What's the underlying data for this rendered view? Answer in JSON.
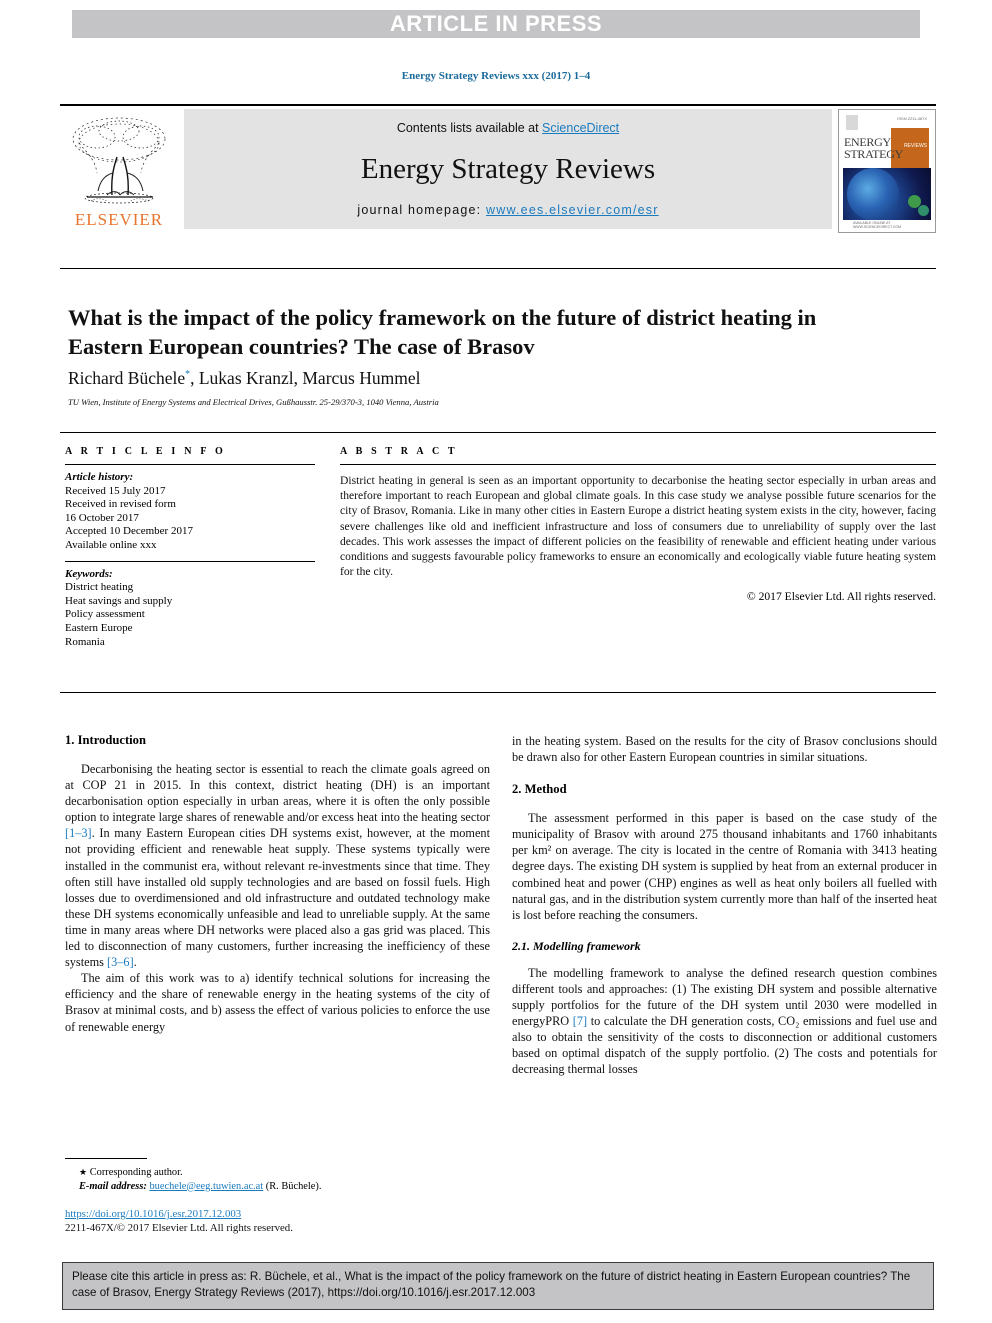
{
  "banner": {
    "text": "ARTICLE IN PRESS"
  },
  "running_head": "Energy Strategy Reviews xxx (2017) 1–4",
  "masthead": {
    "publisher": "ELSEVIER",
    "contents_prefix": "Contents lists available at ",
    "sciencedirect": "ScienceDirect",
    "journal_title": "Energy Strategy Reviews",
    "homepage_prefix": "journal homepage: ",
    "homepage_url": "www.ees.elsevier.com/esr",
    "cover": {
      "title_line1": "ENERGY",
      "title_line2": "STRATEGY",
      "badge": "REVIEWS",
      "top_note": "ISSN 2211-467X",
      "foot_note": "AVAILABLE ONLINE AT WWW.SCIENCEDIRECT.COM"
    }
  },
  "article": {
    "title": "What is the impact of the policy framework on the future of district heating in Eastern European countries? The case of Brasov",
    "authors": "Richard Büchele",
    "authors_rest": ", Lukas Kranzl, Marcus Hummel",
    "corresponding_marker": "*",
    "affiliation": "TU Wien, Institute of Energy Systems and Electrical Drives, Gußhausstr. 25-29/370-3, 1040 Vienna, Austria"
  },
  "article_info": {
    "heading": "A R T I C L E   I N F O",
    "history_label": "Article history:",
    "history": [
      "Received 15 July 2017",
      "Received in revised form",
      "16 October 2017",
      "Accepted 10 December 2017",
      "Available online xxx"
    ],
    "keywords_label": "Keywords:",
    "keywords": [
      "District heating",
      "Heat savings and supply",
      "Policy assessment",
      "Eastern Europe",
      "Romania"
    ]
  },
  "abstract": {
    "heading": "A B S T R A C T",
    "text": "District heating in general is seen as an important opportunity to decarbonise the heating sector especially in urban areas and therefore important to reach European and global climate goals. In this case study we analyse possible future scenarios for the city of Brasov, Romania. Like in many other cities in Eastern Europe a district heating system exists in the city, however, facing severe challenges like old and inefficient infrastructure and loss of consumers due to unreliability of supply over the last decades. This work assesses the impact of different policies on the feasibility of renewable and efficient heating under various conditions and suggests favourable policy frameworks to ensure an economically and ecologically viable future heating system for the city.",
    "copyright": "© 2017 Elsevier Ltd. All rights reserved."
  },
  "body": {
    "intro_heading": "1. Introduction",
    "intro_p1_a": "Decarbonising the heating sector is essential to reach the climate goals agreed on at COP 21 in 2015. In this context, district heating (DH) is an important decarbonisation option especially in urban areas, where it is often the only possible option to integrate large shares of renewable and/or excess heat into the heating sector ",
    "intro_p1_ref1": "[1–3]",
    "intro_p1_b": ". In many Eastern European cities DH systems exist, however, at the moment not providing efficient and renewable heat supply. These systems typically were installed in the communist era, without relevant re-investments since that time. They often still have installed old supply technologies and are based on fossil fuels. High losses due to overdimensioned and old infrastructure and outdated technology make these DH systems economically unfeasible and lead to unreliable supply. At the same time in many areas where DH networks were placed also a gas grid was placed. This led to disconnection of many customers, further increasing the inefficiency of these systems ",
    "intro_p1_ref2": "[3–6]",
    "intro_p1_c": ".",
    "intro_p2_a": "The aim of this work was to a) identify technical solutions for increasing the efficiency and the share of renewable energy in the heating systems of the city of Brasov at minimal costs, and b) assess the effect of various policies to enforce the use of renewable energy",
    "intro_p2_cont": "in the heating system. Based on the results for the city of Brasov conclusions should be drawn also for other Eastern European countries in similar situations.",
    "method_heading": "2. Method",
    "method_p1": "The assessment performed in this paper is based on the case study of the municipality of Brasov with around 275 thousand inhabitants and 1760 inhabitants per km² on average. The city is located in the centre of Romania with 3413 heating degree days. The existing DH system is supplied by heat from an external producer in combined heat and power (CHP) engines as well as heat only boilers all fuelled with natural gas, and in the distribution system currently more than half of the inserted heat is lost before reaching the consumers.",
    "modelling_heading": "2.1. Modelling framework",
    "modelling_p1_a": "The modelling framework to analyse the defined research question combines different tools and approaches: (1) The existing DH system and possible alternative supply portfolios for the future of the DH system until 2030 were modelled in energyPRO ",
    "modelling_p1_ref": "[7]",
    "modelling_p1_b": " to calculate the DH generation costs, CO₂ emissions and fuel use and also to obtain the sensitivity of the costs to disconnection or additional customers based on optimal dispatch of the supply portfolio. (2) The costs and potentials for decreasing thermal losses"
  },
  "footnotes": {
    "corresponding": "Corresponding author.",
    "email_label": "E-mail address:",
    "email": "buechele@eeg.tuwien.ac.at",
    "email_suffix": "(R. Büchele).",
    "doi": "https://doi.org/10.1016/j.esr.2017.12.003",
    "issn": "2211-467X/© 2017 Elsevier Ltd. All rights reserved."
  },
  "citation_box": {
    "text": "Please cite this article in press as: R. Büchele, et al., What is the impact of the policy framework on the future of district heating in Eastern European countries? The case of Brasov, Energy Strategy Reviews (2017), https://doi.org/10.1016/j.esr.2017.12.003"
  },
  "colors": {
    "link": "#1b7bbf",
    "banner_bg": "#c4c4c6",
    "masthead_bg": "#e3e3e3",
    "elsevier_orange": "#e8742c"
  }
}
